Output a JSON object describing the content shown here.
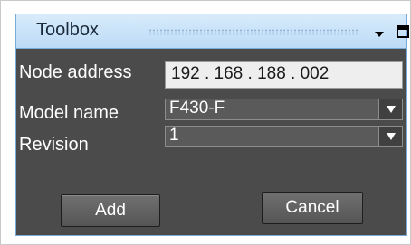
{
  "window": {
    "title": "Toolbox",
    "menu_icon": "dropdown-arrow-icon",
    "maximize_icon": "maximize-box-icon"
  },
  "form": {
    "node_address_label": "Node address",
    "node_address_value": "192 . 168 . 188 . 002",
    "model_name_label": "Model name",
    "model_name_value": "F430-F",
    "revision_label": "Revision",
    "revision_value": "1"
  },
  "buttons": {
    "add": "Add",
    "cancel": "Cancel"
  },
  "colors": {
    "titlebar": "#c9e2f8",
    "panel": "#4b4b4b",
    "field": "#eeeeee"
  }
}
